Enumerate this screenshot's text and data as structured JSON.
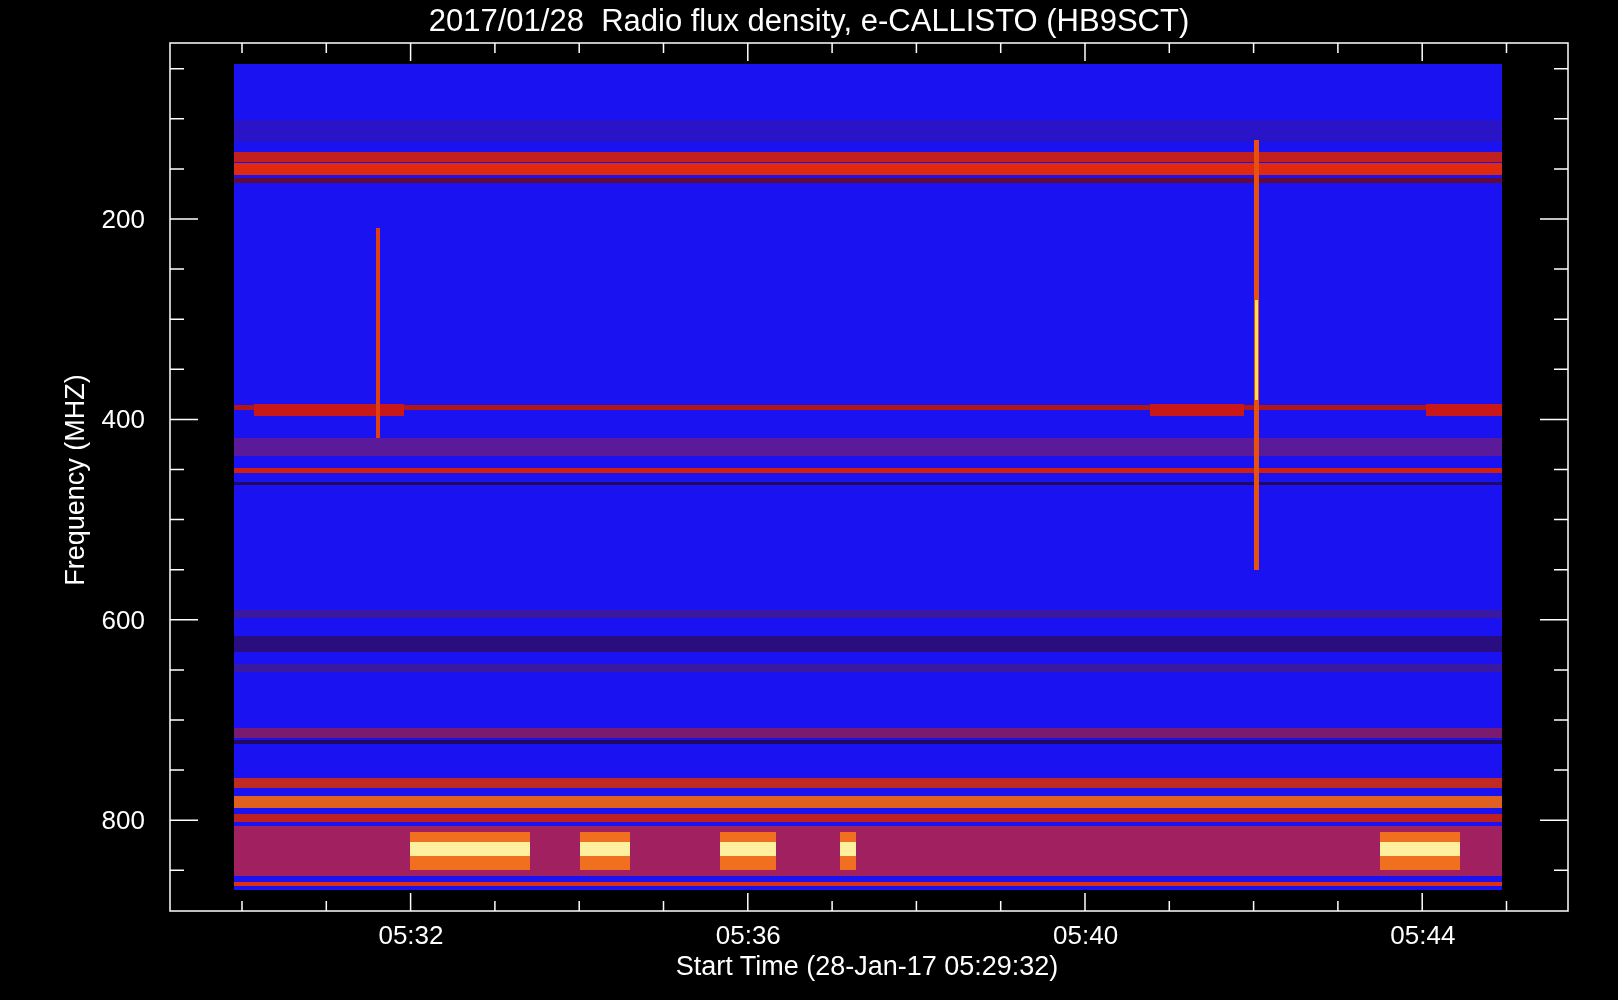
{
  "title": "2017/01/28  Radio flux density, e-CALLISTO (HB9SCT)",
  "plot": {
    "ylabel": "Frequency (MHZ)",
    "xlabel": "Start Time (28-Jan-17 05:29:32)",
    "yticks": [
      "200",
      "400",
      "600",
      "800"
    ],
    "xticks": [
      "05:32",
      "05:36",
      "05:40",
      "05:44"
    ]
  }
}
